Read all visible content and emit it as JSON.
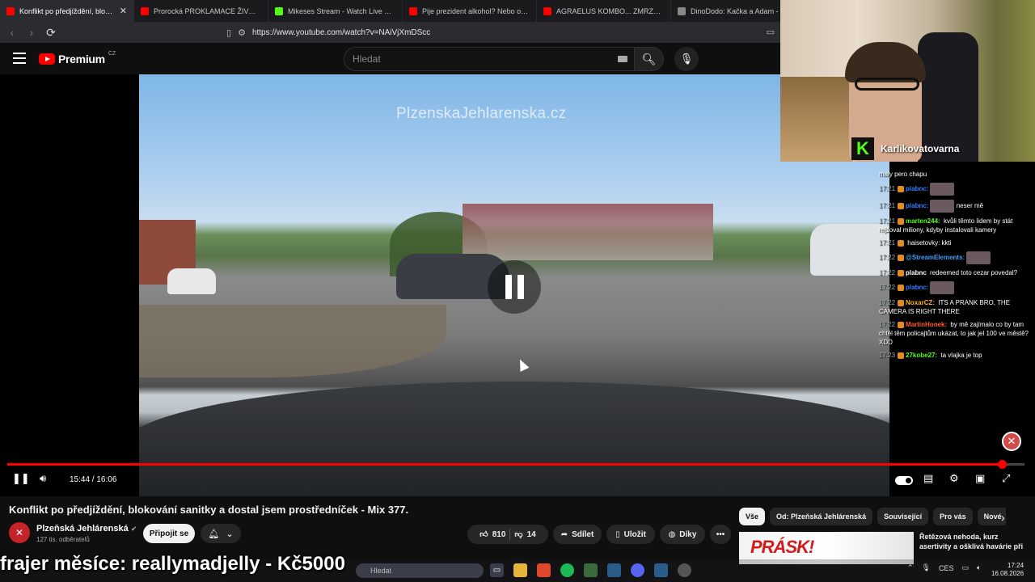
{
  "browser": {
    "tabs": [
      {
        "title": "Konflikt po předjíždění, blokov",
        "color": "#ff0000",
        "active": true
      },
      {
        "title": "Prorocká PROKLAMACE ŽIVOTA. Chv",
        "color": "#ff0000"
      },
      {
        "title": "Mikeses Stream - Watch Live on K",
        "color": "#53fc18"
      },
      {
        "title": "Pije prezident alkohol? Nebo omezil",
        "color": "#ff0000"
      },
      {
        "title": "AGRAELUS KOMBO... ZMRZKA A PO",
        "color": "#ff0000"
      },
      {
        "title": "DinoDodo: Kačka a Adam - sourc",
        "color": "#888888"
      }
    ],
    "close_tab_glyph": "✕",
    "url": "https://www.youtube.com/watch?v=NAiVjXmDScc"
  },
  "youtube": {
    "logo_text": "Premium",
    "logo_region": "CZ",
    "search_placeholder": "Hledat",
    "video": {
      "watermark": "PlzenskaJehlarenska.cz",
      "time": "15:44 / 16:06",
      "progress": 0.978
    },
    "title": "Konflikt po předjíždění, blokování sanitky a dostal jsem prostředníček - Mix 377.",
    "channel": {
      "name": "Plzeňská Jehlárenská",
      "verified": "✔",
      "subscribers": "127 tis. odběratelů",
      "join_label": "Připojit se"
    },
    "actions": {
      "likes": "810",
      "dislikes": "14",
      "share": "Sdílet",
      "save": "Uložit",
      "thanks": "Díky",
      "more": "•••"
    },
    "chips": [
      "Vše",
      "Od: Plzeňská Jehlárenská",
      "Související",
      "Pro vás",
      "Nové"
    ],
    "related": {
      "thumb_text": "PRÁSK!",
      "title": "Řetězová nehoda, kurz asertivity a ošklivá havárie při"
    }
  },
  "overlay": {
    "donor": "frajer měsíce: reallymadjelly - Kč5000",
    "webcam_name": "Karlikovatovarna",
    "kick_logo": "K"
  },
  "chat": [
    {
      "time": "",
      "user": "",
      "user_color": "#ffffff",
      "text": "maly pero chapu",
      "emote": false
    },
    {
      "time": "17:21",
      "user": "plabnc:",
      "user_color": "#2f7cff",
      "text": "",
      "emote": true
    },
    {
      "time": "17:21",
      "user": "plabnc:",
      "user_color": "#2f7cff",
      "text": "neser mě",
      "emote": true
    },
    {
      "time": "17:21",
      "user": "marten244:",
      "user_color": "#53fc18",
      "text": "kvůli těmto lidem by stát rejžoval miliony, kdyby instalovali kamery",
      "emote": false
    },
    {
      "time": "17:21",
      "user": "",
      "user_color": "#ffffff",
      "text": "haisetovky: kkti",
      "emote": false
    },
    {
      "time": "17:22",
      "user": "@StreamElements:",
      "user_color": "#3aa0ff",
      "text": "",
      "emote": true
    },
    {
      "time": "17:22",
      "user": "plabnc",
      "user_color": "#ffffff",
      "text": "redeemed toto cezar povedal?",
      "emote": false
    },
    {
      "time": "17:22",
      "user": "plabnc:",
      "user_color": "#2f7cff",
      "text": "",
      "emote": true
    },
    {
      "time": "17:22",
      "user": "NoxarCZ:",
      "user_color": "#ffb020",
      "text": "ITS A PRANK BRO, THE CAMERA IS RIGHT THERE",
      "emote": false
    },
    {
      "time": "17:22",
      "user": "MartinHonek:",
      "user_color": "#ff5a2a",
      "text": "by mě zajímalo co by tam chtěl těm policajtům ukázat, to jak jel 100 ve městě? XDD",
      "emote": false
    },
    {
      "time": "17:23",
      "user": "27kobe27:",
      "user_color": "#53fc18",
      "text": "ta vlajka je top",
      "emote": false
    }
  ],
  "taskbar": {
    "search_placeholder": "Hledat",
    "tray_lang": "CES",
    "time": "17:24",
    "date": "16.08.2026"
  },
  "colors": {
    "accent": "#ff0000",
    "kick_green": "#53fc18",
    "bg": "#0f0f0f"
  }
}
